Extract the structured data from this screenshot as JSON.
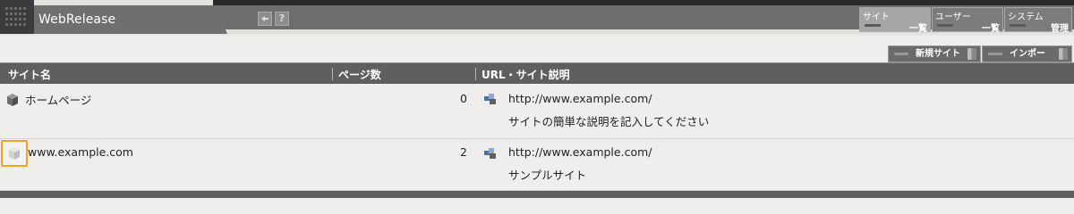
{
  "app": {
    "title": "WebRelease"
  },
  "nav": [
    {
      "top": "サイト",
      "bottom": "一覧",
      "active": true
    },
    {
      "top": "ユーザー",
      "bottom": "一覧",
      "active": false
    },
    {
      "top": "システム",
      "bottom": "管理",
      "active": false
    }
  ],
  "header_icons": [
    "back-icon",
    "help-icon"
  ],
  "help_glyph": "?",
  "toolbar": {
    "new_site": "新規サイト",
    "import": "インポート"
  },
  "table": {
    "columns": [
      "サイト名",
      "ページ数",
      "URL・サイト説明"
    ],
    "rows": [
      {
        "name": "ホームページ",
        "pages": "0",
        "url": "http://www.example.com/",
        "description": "サイトの簡単な説明を記入してください",
        "selected": false
      },
      {
        "name": "www.example.com",
        "pages": "2",
        "url": "http://www.example.com/",
        "description": "サンプルサイト",
        "selected": true
      }
    ]
  },
  "colors": {
    "header_bg": "#5f5f5f",
    "selection": "#f4a320",
    "page_bg": "#efeeec"
  }
}
